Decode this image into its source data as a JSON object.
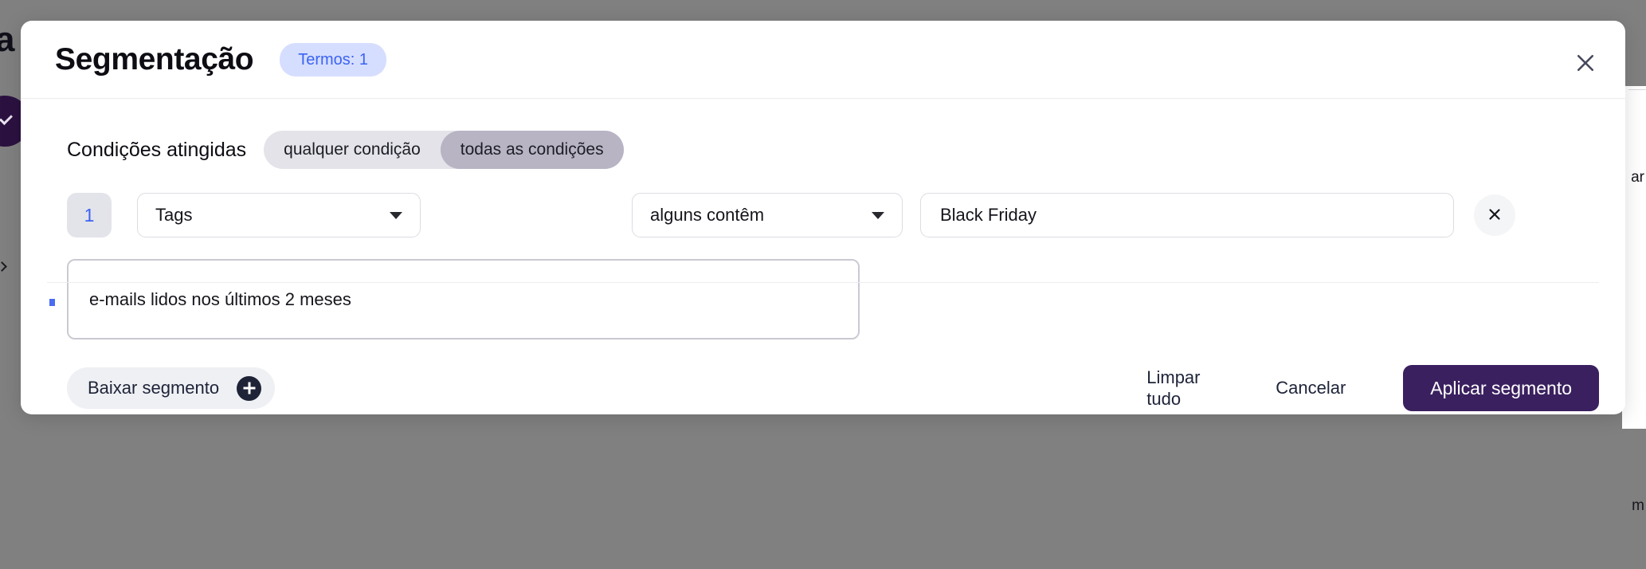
{
  "background": {
    "left_letter": "a",
    "right_label_top": "ar",
    "right_label_bottom": "m"
  },
  "modal": {
    "title": "Segmentação",
    "terms_badge": "Termos: 1",
    "close_icon": "close-icon",
    "conditions": {
      "label": "Condições atingidas",
      "options": [
        {
          "label": "qualquer condição",
          "active": false
        },
        {
          "label": "todas as condições",
          "active": true
        }
      ]
    },
    "filter_row": {
      "index": "1",
      "field_select": {
        "value": "Tags",
        "icon": "chevron-down-icon"
      },
      "operator_select": {
        "value": "alguns contêm",
        "icon": "chevron-down-icon"
      },
      "value_input": {
        "value": "Black Friday",
        "placeholder": ""
      },
      "remove_icon": "close-icon"
    },
    "note": {
      "value": "e-mails lidos nos últimos 2 meses",
      "placeholder": ""
    },
    "footer": {
      "download_label": "Baixar segmento",
      "download_icon": "plus-circle-icon",
      "clear_all_label": "Limpar tudo",
      "cancel_label": "Cancelar",
      "apply_label": "Aplicar segmento"
    }
  },
  "colors": {
    "accent_purple": "#3a205f",
    "badge_blue_bg": "#d6deff",
    "badge_blue_text": "#3b63f2",
    "toggle_track": "#e3e3e9",
    "toggle_active": "#b8b4c4",
    "dark_navy": "#1e2338",
    "overlay": "#808080"
  }
}
